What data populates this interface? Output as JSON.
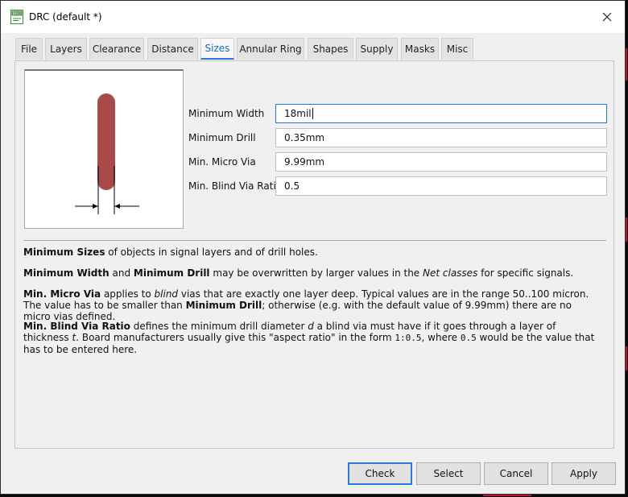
{
  "window": {
    "title": "DRC (default *)",
    "icon_text": "BRD"
  },
  "tabs": [
    {
      "label": "File"
    },
    {
      "label": "Layers"
    },
    {
      "label": "Clearance"
    },
    {
      "label": "Distance"
    },
    {
      "label": "Sizes",
      "active": true
    },
    {
      "label": "Annular Ring"
    },
    {
      "label": "Shapes"
    },
    {
      "label": "Supply"
    },
    {
      "label": "Masks"
    },
    {
      "label": "Misc"
    }
  ],
  "fields": [
    {
      "label": "Minimum Width",
      "value": "18mil"
    },
    {
      "label": "Minimum Drill",
      "value": "0.35mm"
    },
    {
      "label": "Min. Micro Via",
      "value": "9.99mm"
    },
    {
      "label": "Min. Blind Via Ratio",
      "value": "0.5"
    }
  ],
  "description": {
    "p1": {
      "b1": "Minimum Sizes",
      "t1": " of objects in signal layers and of drill holes."
    },
    "p2": {
      "b1": "Minimum Width",
      "t1": " and ",
      "b2": "Minimum Drill",
      "t2": " may be overwritten by larger values in the ",
      "i1": "Net classes",
      "t3": " for specific signals."
    },
    "p3": {
      "b1": "Min. Micro Via",
      "t1": " applies to ",
      "i1": "blind",
      "t2": " vias that are exactly one layer deep. Typical values are in the range 50..100 micron. The value has to be smaller than ",
      "b2": "Minimum Drill",
      "t3": "; otherwise (e.g. with the default value of 9.99mm) there are no micro vias defined."
    },
    "p4": {
      "b1": "Min. Blind Via Ratio",
      "t1": " defines the minimum drill diameter ",
      "i1": "d",
      "t2": " a blind via must have if it goes through a layer of thickness ",
      "i2": "t",
      "t3": ". Board manufacturers usually give this \"aspect ratio\" in the form ",
      "m1": "1:0.5",
      "t4": ", where ",
      "m2": "0.5",
      "t5": " would be the value that has to be entered here."
    }
  },
  "buttons": {
    "check": "Check",
    "select": "Select",
    "cancel": "Cancel",
    "apply": "Apply"
  },
  "colors": {
    "accent": "#2b7bd6",
    "wire_fill": "#a94a4a",
    "background_pcb": "#b8162b"
  }
}
